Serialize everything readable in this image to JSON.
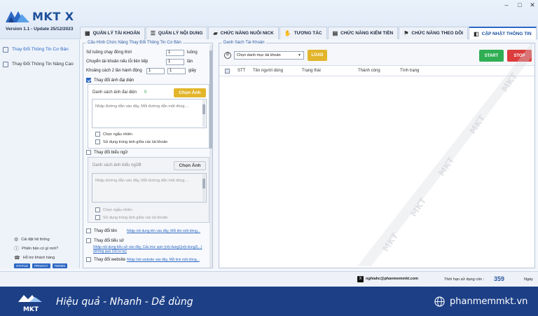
{
  "app": {
    "name": "MKT X",
    "version_label": "Version",
    "version": "1.1",
    "update": "- Update  25/12/2023"
  },
  "window_controls": [
    "–",
    "□",
    "✕"
  ],
  "tabs": [
    {
      "label": "QUẢN LÝ TÀI KHOẢN",
      "icon": "grid-icon"
    },
    {
      "label": "QUẢN LÝ NỘI DUNG",
      "icon": "list-icon"
    },
    {
      "label": "CHỨC NĂNG NUÔI NICK",
      "icon": "car-icon"
    },
    {
      "label": "TƯƠNG TÁC",
      "icon": "hand-icon"
    },
    {
      "label": "CHỨC NĂNG KIỂM TIỀN",
      "icon": "money-icon"
    },
    {
      "label": "CHỨC NĂNG THEO DÕI",
      "icon": "flag-icon"
    },
    {
      "label": "CẬP NHẬT THÔNG TIN",
      "icon": "account-icon",
      "active": true
    }
  ],
  "sidebar": {
    "items": [
      {
        "label": "Thay Đổi Thông Tin Cơ Bản",
        "active": true
      },
      {
        "label": "Thay Đổi Thông Tin Nâng Cao",
        "active": false
      }
    ],
    "bottom": [
      {
        "label": "Cài đặt hệ thống",
        "icon": "gear-icon"
      },
      {
        "label": "Phiên bản có gì mới?",
        "icon": "info-icon"
      },
      {
        "label": "Hỗ trợ khách hàng",
        "icon": "support-icon"
      }
    ],
    "pills": [
      "STATUS",
      "PRIVACY",
      "TERMS"
    ]
  },
  "config": {
    "title": "Cấu Hình Chức Năng Thay Đổi Thông Tin Cơ Bản",
    "threads_label": "Số luồng chạy đồng thời",
    "threads_value": "1",
    "threads_unit": "luồng",
    "retry_label": "Chuyển tài khoản nếu lỗi liên tiếp",
    "retry_value": "1",
    "retry_unit": "lần",
    "delay_label": "Khoảng cách 2 lần hành động",
    "delay_from": "1",
    "delay_to": "1",
    "delay_unit": "giây",
    "avatar": {
      "label": "Thay đổi ảnh đại diện",
      "checked": true,
      "list_label": "Danh sách ảnh đại diện",
      "count": "0",
      "button": "Chọn Ảnh",
      "placeholder": "Nhập đường dẫn vào đây, Mỗi đường dẫn một dòng....",
      "opt_random": "Chọn ngẫu nhiên",
      "opt_duplicate": "Sử dụng trùng ảnh giữa các tài khoản"
    },
    "cover": {
      "label": "Thay đổi biểu ngữ",
      "checked": false,
      "list_label": "Danh sách ảnh biểu ngữ",
      "count": "0",
      "button": "Chọn Ảnh",
      "placeholder": "Nhập đường dẫn vào đây, Mỗi đường dẫn một dòng....",
      "opt_random": "Chọn ngẫu nhiên",
      "opt_duplicate": "Sử dụng trùng ảnh giữa các tài khoản"
    },
    "name": {
      "label": "Thay đổi tên",
      "hint": "Nhập nội dung tên vào đây, Mỗi tên một dòng..."
    },
    "bio": {
      "label": "Thay đổi tiểu sử",
      "hint": "Nhập nội dung tiểu sử vào đây, Cấu trúc spin {nội dung1|nội dung2|...}",
      "hint2": "(không quá 150 kí tự)"
    },
    "website": {
      "label": "Thay đổi website",
      "hint": "Nhập link website vào đây, Mỗi link một dòng..."
    }
  },
  "accounts": {
    "title": "Danh Sách Tài Khoản",
    "select_placeholder": "Chọn danh mục tài khoản",
    "load": "LOAD",
    "start": "START",
    "stop": "STOP",
    "columns": [
      "STT",
      "Tên người dùng",
      "Trạng thái",
      "Thành công",
      "Tình trạng"
    ]
  },
  "watermark": "MKT",
  "status": {
    "email": "nghiahc@phanmemmkt.com",
    "expiry_label": "Thời hạn sử dụng còn :",
    "days": "359",
    "days_unit": "Ngày"
  },
  "footer": {
    "brand": "MKT",
    "slogan": "Hiệu quả - Nhanh - Dễ dùng",
    "website": "phanmemmkt.vn"
  },
  "colors": {
    "accent": "#2d68c4",
    "navy": "#1c3f86",
    "yellow": "#e2b52b",
    "green": "#2fae54",
    "red": "#dc3c3c"
  }
}
